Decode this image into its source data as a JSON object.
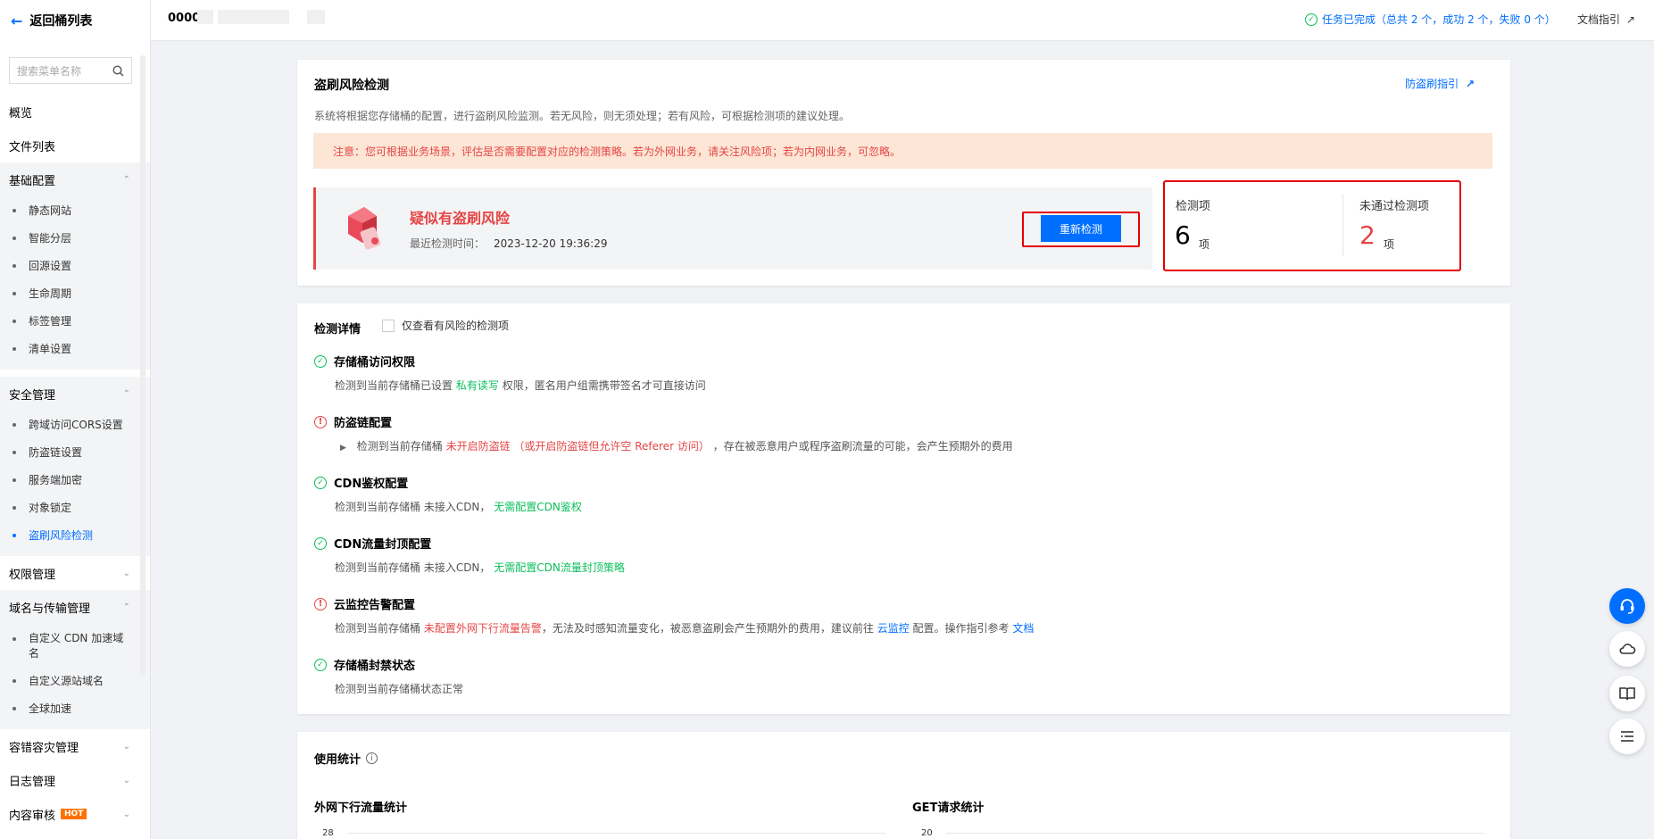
{
  "sidebar": {
    "back_label": "返回桶列表",
    "search_placeholder": "搜索菜单名称",
    "items_top": [
      "概览",
      "文件列表"
    ],
    "basic": {
      "title": "基础配置",
      "items": [
        "静态网站",
        "智能分层",
        "回源设置",
        "生命周期",
        "标签管理",
        "清单设置"
      ]
    },
    "security": {
      "title": "安全管理",
      "items": [
        "跨域访问CORS设置",
        "防盗链设置",
        "服务端加密",
        "对象锁定",
        "盗刷风险检测"
      ]
    },
    "permission": {
      "title": "权限管理"
    },
    "domain": {
      "title": "域名与传输管理",
      "items": [
        "自定义 CDN 加速域名",
        "自定义源站域名",
        "全球加速"
      ]
    },
    "disaster": {
      "title": "容错容灾管理"
    },
    "log": {
      "title": "日志管理"
    },
    "audit": {
      "title": "内容审核",
      "badge": "HOT"
    }
  },
  "topbar": {
    "bucket_name": "0000",
    "task_status": "任务已完成（总共 2 个，成功 2 个，失败 0 个）",
    "doc_guide": "文档指引"
  },
  "risk_card": {
    "title": "盗刷风险检测",
    "guide_link": "防盗刷指引",
    "description": "系统将根据您存储桶的配置，进行盗刷风险监测。若无风险，则无须处理；若有风险，可根据检测项的建议处理。",
    "notice": "注意：您可根据业务场景，评估是否需要配置对应的检测策略。若为外网业务，请关注风险项；若为内网业务，可忽略。",
    "status_title": "疑似有盗刷风险",
    "last_check_label": "最近检测时间：",
    "last_check_time": "2023-12-20 19:36:29",
    "recheck_button": "重新检测",
    "items_label": "检测项",
    "items_count": "6",
    "unit": "项",
    "failed_label": "未通过检测项",
    "failed_count": "2",
    "colors": {
      "accent": "#006eff",
      "danger": "#e54545",
      "success": "#0abf5b"
    }
  },
  "detail_card": {
    "title": "检测详情",
    "filter_label": "仅查看有风险的检测项",
    "items": [
      {
        "status": "pass",
        "title": "存储桶访问权限",
        "desc_a": "检测到当前存储桶已设置",
        "desc_hl": "私有读写",
        "desc_b": "权限，匿名用户组需携带签名才可直接访问"
      },
      {
        "status": "fail",
        "title": "防盗链配置",
        "desc_a": "检测到当前存储桶",
        "desc_hl": "未开启防盗链 （或开启防盗链但允许空 Referer 访问）",
        "desc_b": "，存在被恶意用户或程序盗刷流量的可能，会产生预期外的费用"
      },
      {
        "status": "pass",
        "title": "CDN鉴权配置",
        "desc_a": "检测到当前存储桶 未接入CDN，",
        "desc_hl": "无需配置CDN鉴权"
      },
      {
        "status": "pass",
        "title": "CDN流量封顶配置",
        "desc_a": "检测到当前存储桶 未接入CDN，",
        "desc_hl": "无需配置CDN流量封顶策略"
      },
      {
        "status": "fail",
        "title": "云监控告警配置",
        "desc_a": "检测到当前存储桶",
        "desc_hl": "未配置外网下行流量告警",
        "desc_b": "，无法及时感知流量变化，被恶意盗刷会产生预期外的费用，建议前往",
        "link1": "云监控",
        "desc_c": "配置。操作指引参考",
        "link2": "文档"
      },
      {
        "status": "pass",
        "title": "存储桶封禁状态",
        "desc_a": "检测到当前存储桶状态正常"
      }
    ]
  },
  "usage_card": {
    "title": "使用统计",
    "chart_left_title": "外网下行流量统计",
    "chart_left_axis_top": "28",
    "chart_right_title": "GET请求统计",
    "chart_right_axis_top": "20"
  },
  "float_icons": [
    "headset-icon",
    "cloud-icon",
    "book-icon",
    "list-icon"
  ]
}
